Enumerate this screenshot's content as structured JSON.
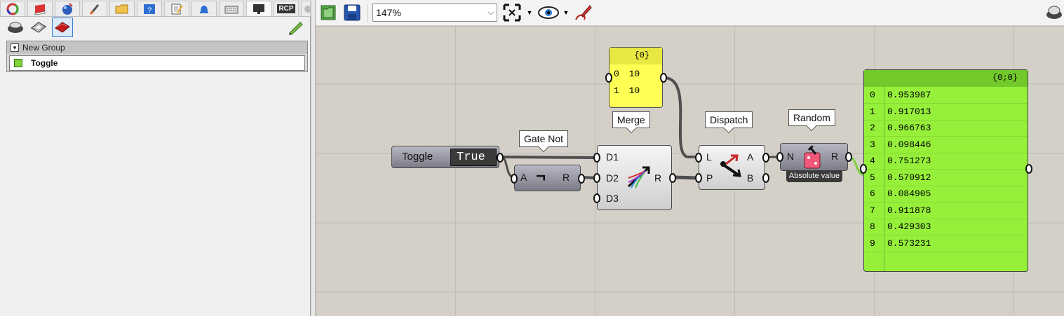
{
  "left_panel": {
    "tabs": [
      {
        "icon": "color-wheel-icon"
      },
      {
        "icon": "book-icon"
      },
      {
        "icon": "sphere-icon"
      },
      {
        "icon": "brush-icon"
      },
      {
        "icon": "folder-icon"
      },
      {
        "icon": "help-icon"
      },
      {
        "icon": "notepad-icon"
      },
      {
        "icon": "bell-icon"
      },
      {
        "icon": "keyboard-icon"
      },
      {
        "icon": "monitor-icon"
      },
      {
        "icon": "rcp-icon",
        "label": "RCP"
      },
      {
        "icon": "gear-icon"
      }
    ],
    "tools": [
      {
        "icon": "eye-icon"
      },
      {
        "icon": "preview-wire-icon"
      },
      {
        "icon": "preview-shaded-icon"
      }
    ],
    "group": {
      "title": "New Group",
      "collapse_glyph": "▾",
      "item_label": "Toggle"
    }
  },
  "toolbar": {
    "zoom_value": "147%",
    "zoom_arrow": "⌵"
  },
  "canvas": {
    "panel_top": {
      "header": "{0}",
      "rows": [
        {
          "index": "0",
          "value": "10"
        },
        {
          "index": "1",
          "value": "10"
        }
      ]
    },
    "toggle": {
      "label": "Toggle",
      "value": "True"
    },
    "gate_not": {
      "bubble": "Gate Not",
      "input": "A",
      "glyph": "¬",
      "output": "R"
    },
    "merge": {
      "bubble": "Merge",
      "inputs": [
        "D1",
        "D2",
        "D3"
      ],
      "output": "R"
    },
    "dispatch": {
      "bubble": "Dispatch",
      "inputs": [
        "L",
        "P"
      ],
      "outputs": [
        "A",
        "B"
      ]
    },
    "random": {
      "bubble": "Random",
      "input": "N",
      "output": "R",
      "footer": "Absolute value"
    },
    "panel_output": {
      "header": "{0;0}",
      "rows": [
        {
          "index": "0",
          "value": "0.953987"
        },
        {
          "index": "1",
          "value": "0.917013"
        },
        {
          "index": "2",
          "value": "0.966763"
        },
        {
          "index": "3",
          "value": "0.098446"
        },
        {
          "index": "4",
          "value": "0.751273"
        },
        {
          "index": "5",
          "value": "0.570912"
        },
        {
          "index": "6",
          "value": "0.084905"
        },
        {
          "index": "7",
          "value": "0.911878"
        },
        {
          "index": "8",
          "value": "0.429303"
        },
        {
          "index": "9",
          "value": "0.573231"
        }
      ]
    }
  },
  "colors": {
    "canvas_bg": "#d4d0c8",
    "panel_yellow": "#ffff55",
    "panel_green": "#96f03a",
    "panel_green_header": "#73c82a",
    "wire": "#4f4f4f",
    "wire_green": "#7ecf3c"
  }
}
